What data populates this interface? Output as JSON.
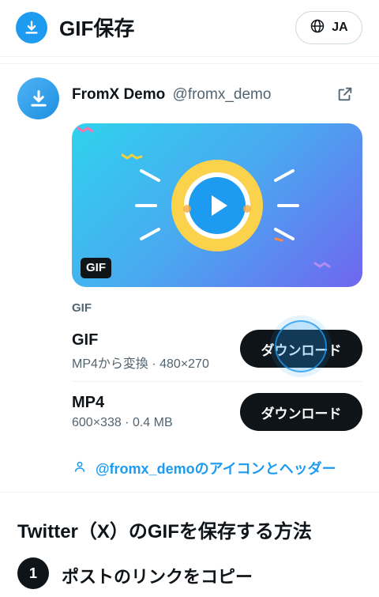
{
  "header": {
    "logo_icon": "download-icon",
    "title": "GIF保存",
    "language": {
      "icon": "globe-icon",
      "label": "JA"
    }
  },
  "post": {
    "avatar_icon": "download-icon",
    "user_name": "FromX Demo",
    "user_handle": "@fromx_demo",
    "external_icon": "external-link-icon",
    "media_badge": "GIF",
    "media_icon": "play-icon"
  },
  "downloads": {
    "section_label": "GIF",
    "options": [
      {
        "title": "GIF",
        "meta": "MP4から変換 · 480×270",
        "button": "ダウンロード"
      },
      {
        "title": "MP4",
        "meta": "600×338 · 0.4 MB",
        "button": "ダウンロード"
      }
    ],
    "profile_link": {
      "icon": "user-icon",
      "label": "@fromx_demoのアイコンとヘッダー"
    }
  },
  "howto": {
    "title": "Twitter（X）のGIFを保存する方法",
    "steps": [
      {
        "number": "1",
        "text": "ポストのリンクをコピー"
      }
    ]
  },
  "colors": {
    "accent": "#1d9bf0",
    "text": "#0f1419",
    "muted": "#536471",
    "button": "#0f1419"
  }
}
